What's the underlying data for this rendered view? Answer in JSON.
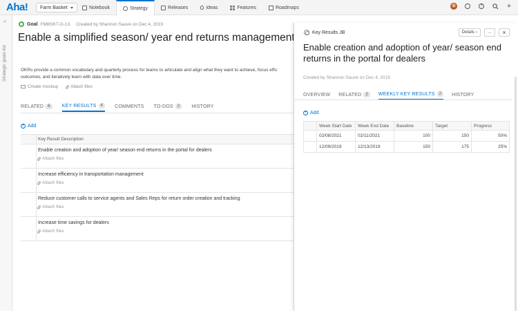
{
  "app": {
    "logo": "Aha!"
  },
  "workspace": {
    "name": "Farm Basket"
  },
  "nav": {
    "tabs": [
      {
        "label": "Notebook",
        "icon": "notebook-icon"
      },
      {
        "label": "Strategy",
        "icon": "strategy-icon",
        "active": true
      },
      {
        "label": "Releases",
        "icon": "releases-icon"
      },
      {
        "label": "Ideas",
        "icon": "ideas-icon"
      },
      {
        "label": "Features",
        "icon": "features-icon"
      },
      {
        "label": "Roadmaps",
        "icon": "roadmaps-icon"
      }
    ]
  },
  "sidebar": {
    "label": "Strategic goals list"
  },
  "goal": {
    "type_label": "Goal",
    "ref": "FMBSKT-G-13",
    "created": "Created by Shannon Sauvé on Dec 4, 2019",
    "title": "Enable a simplified season/ year end returns management e",
    "description_line1": "OKRs provide a common vocabulary and quarterly process for teams to articulate and align what they want to achieve, focus effo",
    "description_line2": "outcomes, and iteratively learn with data over time.",
    "create_mockup": "Create mockup",
    "attach_files": "Attach files"
  },
  "tabs": [
    {
      "label": "RELATED",
      "count": "6"
    },
    {
      "label": "KEY RESULTS",
      "count": "4",
      "active": true
    },
    {
      "label": "COMMENTS",
      "count": ""
    },
    {
      "label": "TO-DOS",
      "count": "2"
    },
    {
      "label": "HISTORY",
      "count": ""
    }
  ],
  "key_results": {
    "add_label": "Add",
    "column_header": "Key Result Description",
    "attach_label": "Attach files",
    "rows": [
      "Enable creation and adoption of year/ season end returns in the portal for dealers",
      "Increase efficiency in transportation management",
      "Reduce customer calls to service agents and Sales Reps for return order creation and tracking",
      "Increase time savings for dealers"
    ]
  },
  "drawer": {
    "header": "Key Results JB",
    "details_label": "Details",
    "more_label": "…",
    "close_label": "×",
    "title": "Enable creation and adoption of year/ season end returns in the portal for dealers",
    "created": "Created by Shannon Sauvé on Dec 4, 2019",
    "tabs": [
      {
        "label": "OVERVIEW",
        "count": ""
      },
      {
        "label": "RELATED",
        "count": "2"
      },
      {
        "label": "WEEKLY KEY RESULTS",
        "count": "2",
        "active": true
      },
      {
        "label": "HISTORY",
        "count": ""
      }
    ],
    "add_label": "Add",
    "table": {
      "headers": [
        "Week Start Date",
        "Week End Date",
        "Baseline",
        "Target",
        "Progress"
      ],
      "rows": [
        [
          "02/08/2021",
          "02/11/2021",
          "100",
          "150",
          "50%"
        ],
        [
          "12/09/2019",
          "12/13/2019",
          "150",
          "175",
          "25%"
        ]
      ]
    }
  },
  "colors": {
    "accent": "#0073cf",
    "goal_green": "#4caf50"
  }
}
